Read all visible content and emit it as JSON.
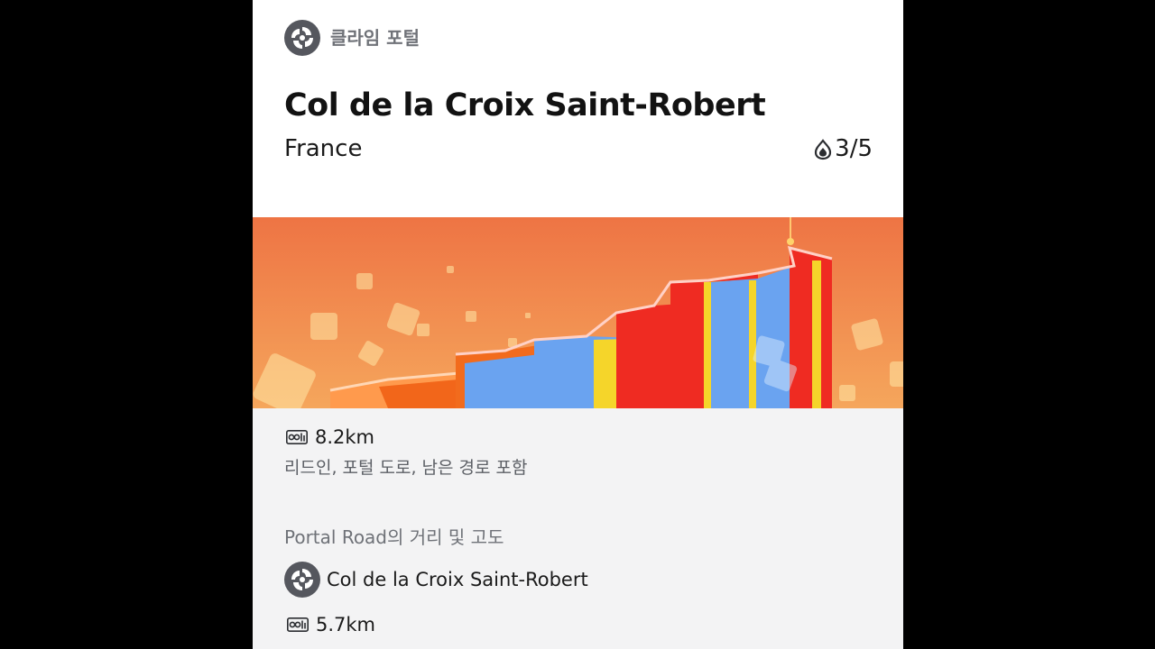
{
  "portal": {
    "label": "클라임 포털",
    "icon": "climb-portal-swirl-icon"
  },
  "climb": {
    "name": "Col de la Croix Saint-Robert",
    "country": "France",
    "difficulty": "3/5",
    "difficulty_icon": "flame-drop-icon"
  },
  "banner": {
    "image": "zigzag-road-illustration",
    "colors": {
      "orange": "#f26b1d",
      "blue": "#6aa3f0",
      "yellow": "#f5d52a",
      "red": "#ef2b22",
      "sky_top": "#ee7a45",
      "sky_bottom": "#f4a05a"
    }
  },
  "details": {
    "distance": "8.2km",
    "distance_icon": "distance-odometer-icon",
    "distance_note": "리드인, 포털 도로, 남은 경로 포함",
    "section_title": "Portal Road의 거리 및 고도",
    "route": {
      "name": "Col de la Croix Saint-Robert",
      "icon": "climb-portal-swirl-icon",
      "distance": "5.7km",
      "distance_icon": "distance-odometer-icon"
    }
  }
}
